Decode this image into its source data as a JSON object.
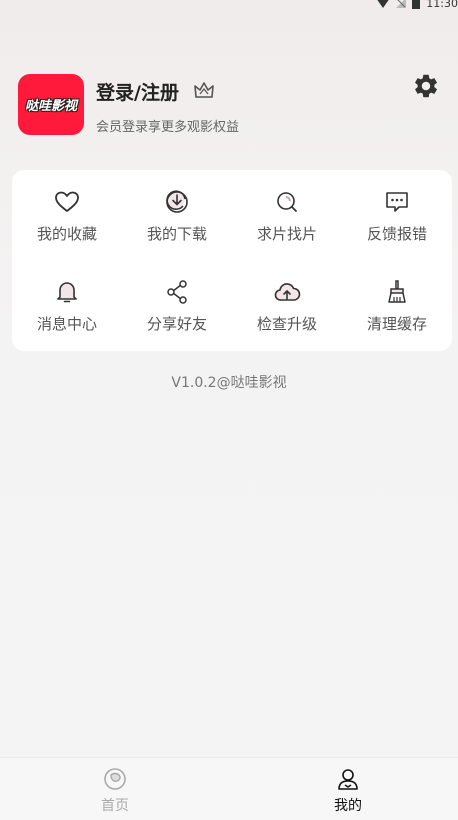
{
  "status_bar": {
    "time": "11:30"
  },
  "profile": {
    "logo_text": "哒哇影视",
    "login_title": "登录/注册",
    "subtitle": "会员登录享更多观影权益"
  },
  "grid": [
    {
      "label": "我的收藏",
      "icon": "heart-icon"
    },
    {
      "label": "我的下载",
      "icon": "download-icon"
    },
    {
      "label": "求片找片",
      "icon": "search-icon"
    },
    {
      "label": "反馈报错",
      "icon": "feedback-icon"
    },
    {
      "label": "消息中心",
      "icon": "bell-icon"
    },
    {
      "label": "分享好友",
      "icon": "share-icon"
    },
    {
      "label": "检查升级",
      "icon": "cloud-upload-icon"
    },
    {
      "label": "清理缓存",
      "icon": "broom-icon"
    }
  ],
  "version": "V1.0.2@哒哇影视",
  "bottom_nav": [
    {
      "label": "首页",
      "active": false
    },
    {
      "label": "我的",
      "active": true
    }
  ],
  "colors": {
    "brand": "#ff1a3c",
    "active_nav": "#111111",
    "inactive_nav": "#aaaaaa"
  }
}
